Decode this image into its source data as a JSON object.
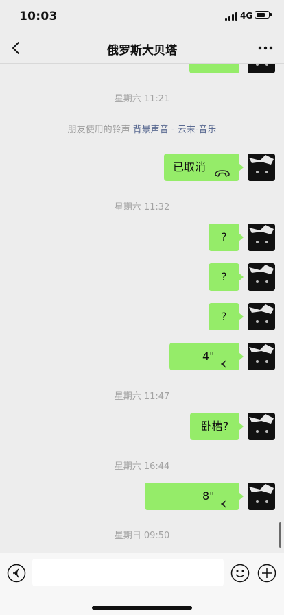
{
  "status": {
    "time": "10:03",
    "network": "4G",
    "battery_level": 0.75
  },
  "nav": {
    "title": "俄罗斯大贝塔"
  },
  "chat": {
    "timestamps": [
      "星期六 11:21",
      "星期六 11:32",
      "星期六 11:47",
      "星期六 16:44",
      "星期日 09:50"
    ],
    "ringtone_notice": {
      "prefix": "朋友使用的铃声 ",
      "link": "背景声音 - 云末-音乐"
    },
    "messages": {
      "cancelled_call": "已取消",
      "q1": "?",
      "q2": "?",
      "q3": "?",
      "voice1_duration": "4\"",
      "text_wocao": "卧槽?",
      "voice2_duration": "8\""
    }
  },
  "colors": {
    "bubble_green": "#95ec69",
    "background": "#ededed",
    "link": "#5b6b92"
  },
  "icons": [
    "back-arrow-icon",
    "more-dots-icon",
    "phone-hangup-icon",
    "voice-wave-icon",
    "voice-input-icon",
    "emoji-icon",
    "add-icon"
  ]
}
